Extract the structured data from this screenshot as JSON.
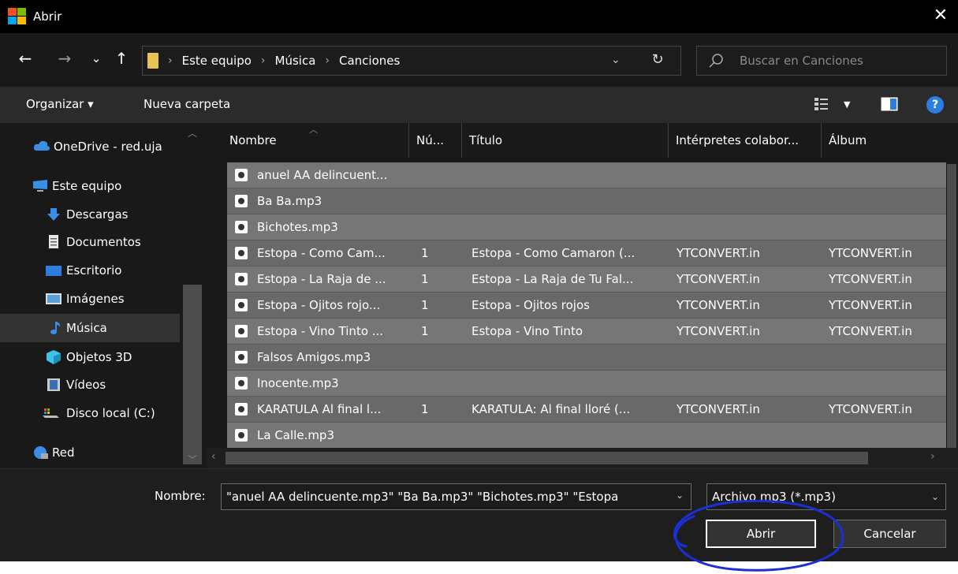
{
  "window": {
    "title": "Abrir",
    "close_glyph": "✕"
  },
  "nav": {
    "back_glyph": "←",
    "forward_glyph": "→",
    "recent_glyph": "⌄",
    "up_glyph": "↑",
    "breadcrumbs": [
      "Este equipo",
      "Música",
      "Canciones"
    ],
    "refresh_glyph": "↻",
    "search_placeholder": "Buscar en Canciones"
  },
  "toolbar": {
    "organize_label": "Organizar ▾",
    "new_folder_label": "Nueva carpeta",
    "help_label": "?"
  },
  "sidebar": {
    "items": [
      {
        "label": "OneDrive - red.uja",
        "icon": "cloud-icon"
      },
      {
        "label": "Este equipo",
        "icon": "computer-icon"
      },
      {
        "label": "Descargas",
        "icon": "download-icon"
      },
      {
        "label": "Documentos",
        "icon": "document-icon"
      },
      {
        "label": "Escritorio",
        "icon": "desktop-icon"
      },
      {
        "label": "Imágenes",
        "icon": "image-icon"
      },
      {
        "label": "Música",
        "icon": "music-icon"
      },
      {
        "label": "Objetos 3D",
        "icon": "cube-icon"
      },
      {
        "label": "Vídeos",
        "icon": "video-icon"
      },
      {
        "label": "Disco local (C:)",
        "icon": "drive-icon"
      },
      {
        "label": "Red",
        "icon": "network-icon"
      }
    ]
  },
  "columns": {
    "name": "Nombre",
    "number": "Nú...",
    "title": "Título",
    "artists": "Intérpretes colabor...",
    "album": "Álbum"
  },
  "files": [
    {
      "name": "anuel AA delincuent...",
      "number": "",
      "title": "",
      "artists": "",
      "album": ""
    },
    {
      "name": "Ba Ba.mp3",
      "number": "",
      "title": "",
      "artists": "",
      "album": ""
    },
    {
      "name": "Bichotes.mp3",
      "number": "",
      "title": "",
      "artists": "",
      "album": ""
    },
    {
      "name": "Estopa - Como Cam...",
      "number": "1",
      "title": "Estopa - Como Camaron (...",
      "artists": "YTCONVERT.in",
      "album": "YTCONVERT.in"
    },
    {
      "name": "Estopa - La Raja de ...",
      "number": "1",
      "title": "Estopa - La Raja de Tu Fal...",
      "artists": "YTCONVERT.in",
      "album": "YTCONVERT.in"
    },
    {
      "name": "Estopa - Ojitos rojo...",
      "number": "1",
      "title": "Estopa - Ojitos rojos",
      "artists": "YTCONVERT.in",
      "album": "YTCONVERT.in"
    },
    {
      "name": "Estopa - Vino Tinto ...",
      "number": "1",
      "title": "Estopa - Vino Tinto",
      "artists": "YTCONVERT.in",
      "album": "YTCONVERT.in"
    },
    {
      "name": "Falsos Amigos.mp3",
      "number": "",
      "title": "",
      "artists": "",
      "album": ""
    },
    {
      "name": "Inocente.mp3",
      "number": "",
      "title": "",
      "artists": "",
      "album": ""
    },
    {
      "name": "KARATULA Al final l...",
      "number": "1",
      "title": "KARATULA: Al final lloré (...",
      "artists": "YTCONVERT.in",
      "album": "YTCONVERT.in"
    },
    {
      "name": "La Calle.mp3",
      "number": "",
      "title": "",
      "artists": "",
      "album": ""
    }
  ],
  "footer": {
    "filename_label": "Nombre:",
    "filename_value": "\"anuel AA delincuente.mp3\" \"Ba Ba.mp3\" \"Bichotes.mp3\" \"Estopa",
    "filter_value": "Archivo mp3 (*.mp3)",
    "open_label": "Abrir",
    "cancel_label": "Cancelar"
  },
  "colors": {
    "row": "#696969",
    "row_alt": "#767676",
    "accent": "#2d7de0",
    "annotation": "#1a2fd6"
  }
}
